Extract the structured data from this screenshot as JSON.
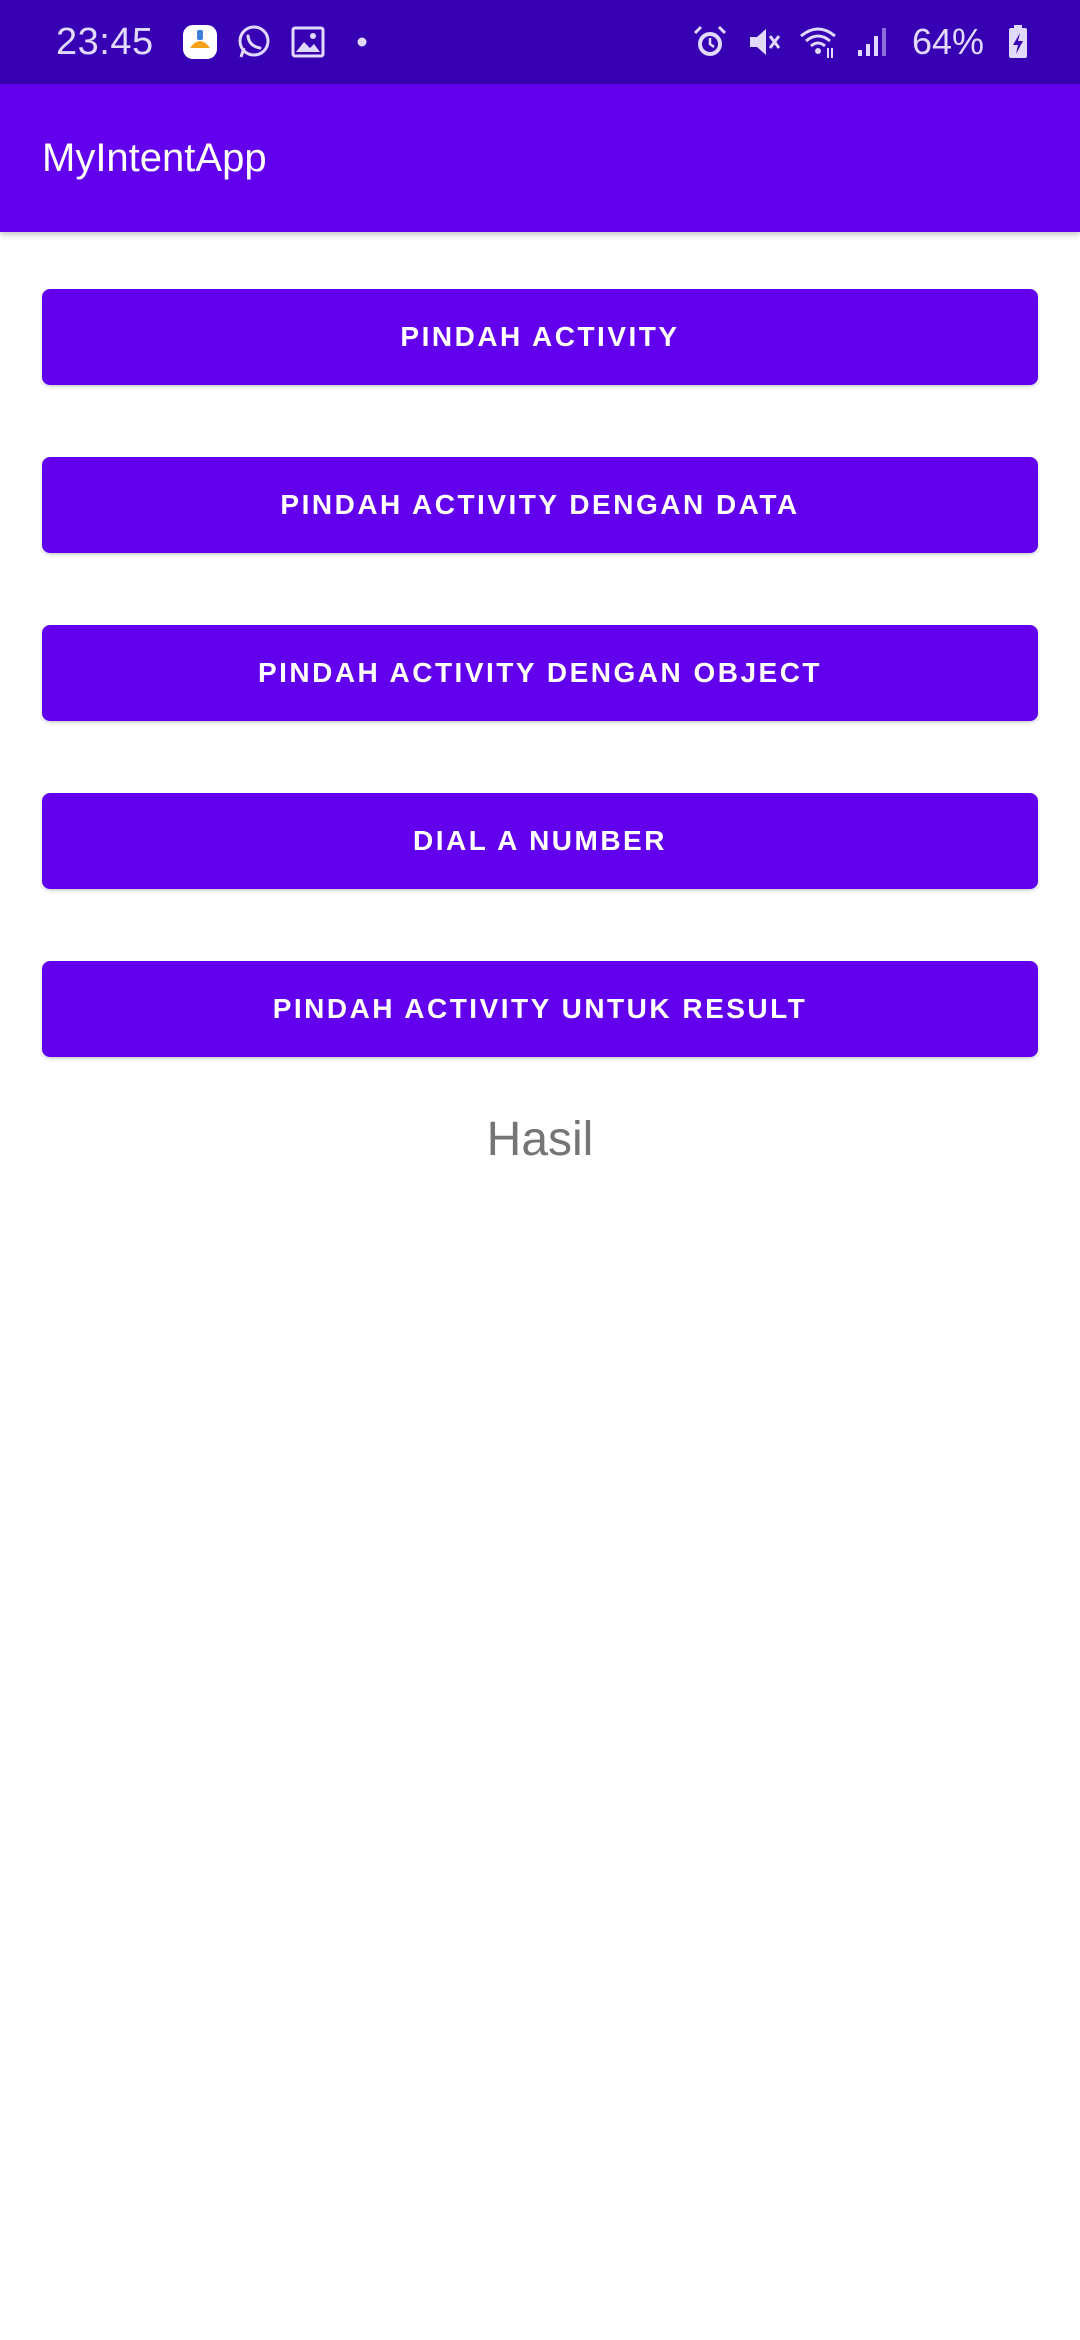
{
  "status_bar": {
    "time": "23:45",
    "battery_percent": "64%",
    "left_icons": [
      "cleaner-app-icon",
      "whatsapp-icon",
      "gallery-icon",
      "dot-icon"
    ],
    "right_icons": [
      "alarm-icon",
      "mute-icon",
      "wifi-icon",
      "signal-icon",
      "battery-charging-icon"
    ]
  },
  "app_bar": {
    "title": "MyIntentApp",
    "color": "#6200ee"
  },
  "buttons": [
    {
      "label": "PINDAH ACTIVITY"
    },
    {
      "label": "PINDAH ACTIVITY DENGAN DATA"
    },
    {
      "label": "PINDAH ACTIVITY DENGAN OBJECT"
    },
    {
      "label": "DIAL A NUMBER"
    },
    {
      "label": "PINDAH ACTIVITY UNTUK RESULT"
    }
  ],
  "result_text": "Hasil",
  "colors": {
    "status_bar": "#3700b3",
    "primary": "#6200ee",
    "result_text": "#757575"
  }
}
